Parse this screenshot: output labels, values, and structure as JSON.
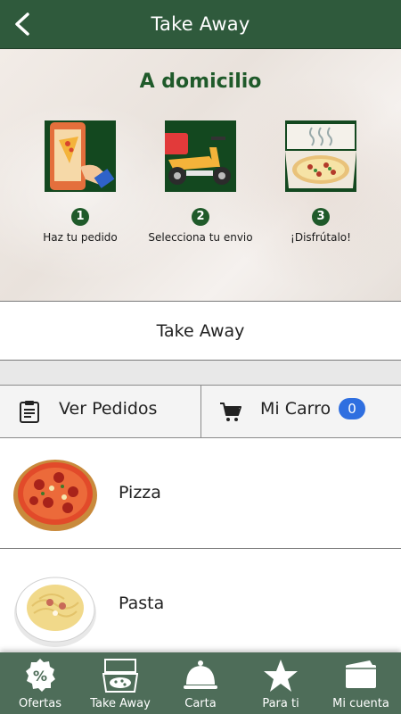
{
  "header": {
    "title": "Take Away",
    "back_icon": "chevron-left-icon"
  },
  "hero": {
    "title": "A domicilio",
    "steps": [
      {
        "number": "1",
        "label": "Haz tu pedido",
        "icon": "phone-order-icon"
      },
      {
        "number": "2",
        "label": "Selecciona tu envio",
        "icon": "delivery-scooter-icon"
      },
      {
        "number": "3",
        "label": "¡Disfrútalo!",
        "icon": "pizza-box-icon"
      }
    ]
  },
  "mode_bar": {
    "label": "Take Away"
  },
  "actions": {
    "orders": {
      "label": "Ver Pedidos",
      "icon": "clipboard-icon"
    },
    "cart": {
      "label": "Mi Carro",
      "icon": "cart-icon",
      "count": "0"
    }
  },
  "categories": [
    {
      "label": "Pizza",
      "image": "pizza-image"
    },
    {
      "label": "Pasta",
      "image": "pasta-image"
    }
  ],
  "bottom_nav": [
    {
      "label": "Ofertas",
      "icon": "percent-icon"
    },
    {
      "label": "Take Away",
      "icon": "pizza-box-icon"
    },
    {
      "label": "Carta",
      "icon": "cloche-icon"
    },
    {
      "label": "Para ti",
      "icon": "star-icon"
    },
    {
      "label": "Mi cuenta",
      "icon": "wallet-icon"
    }
  ],
  "colors": {
    "header_bg": "#2f5a3c",
    "brand_green": "#1f5a2a",
    "nav_bg": "#4e6d59",
    "badge_blue": "#2f6fe0"
  }
}
